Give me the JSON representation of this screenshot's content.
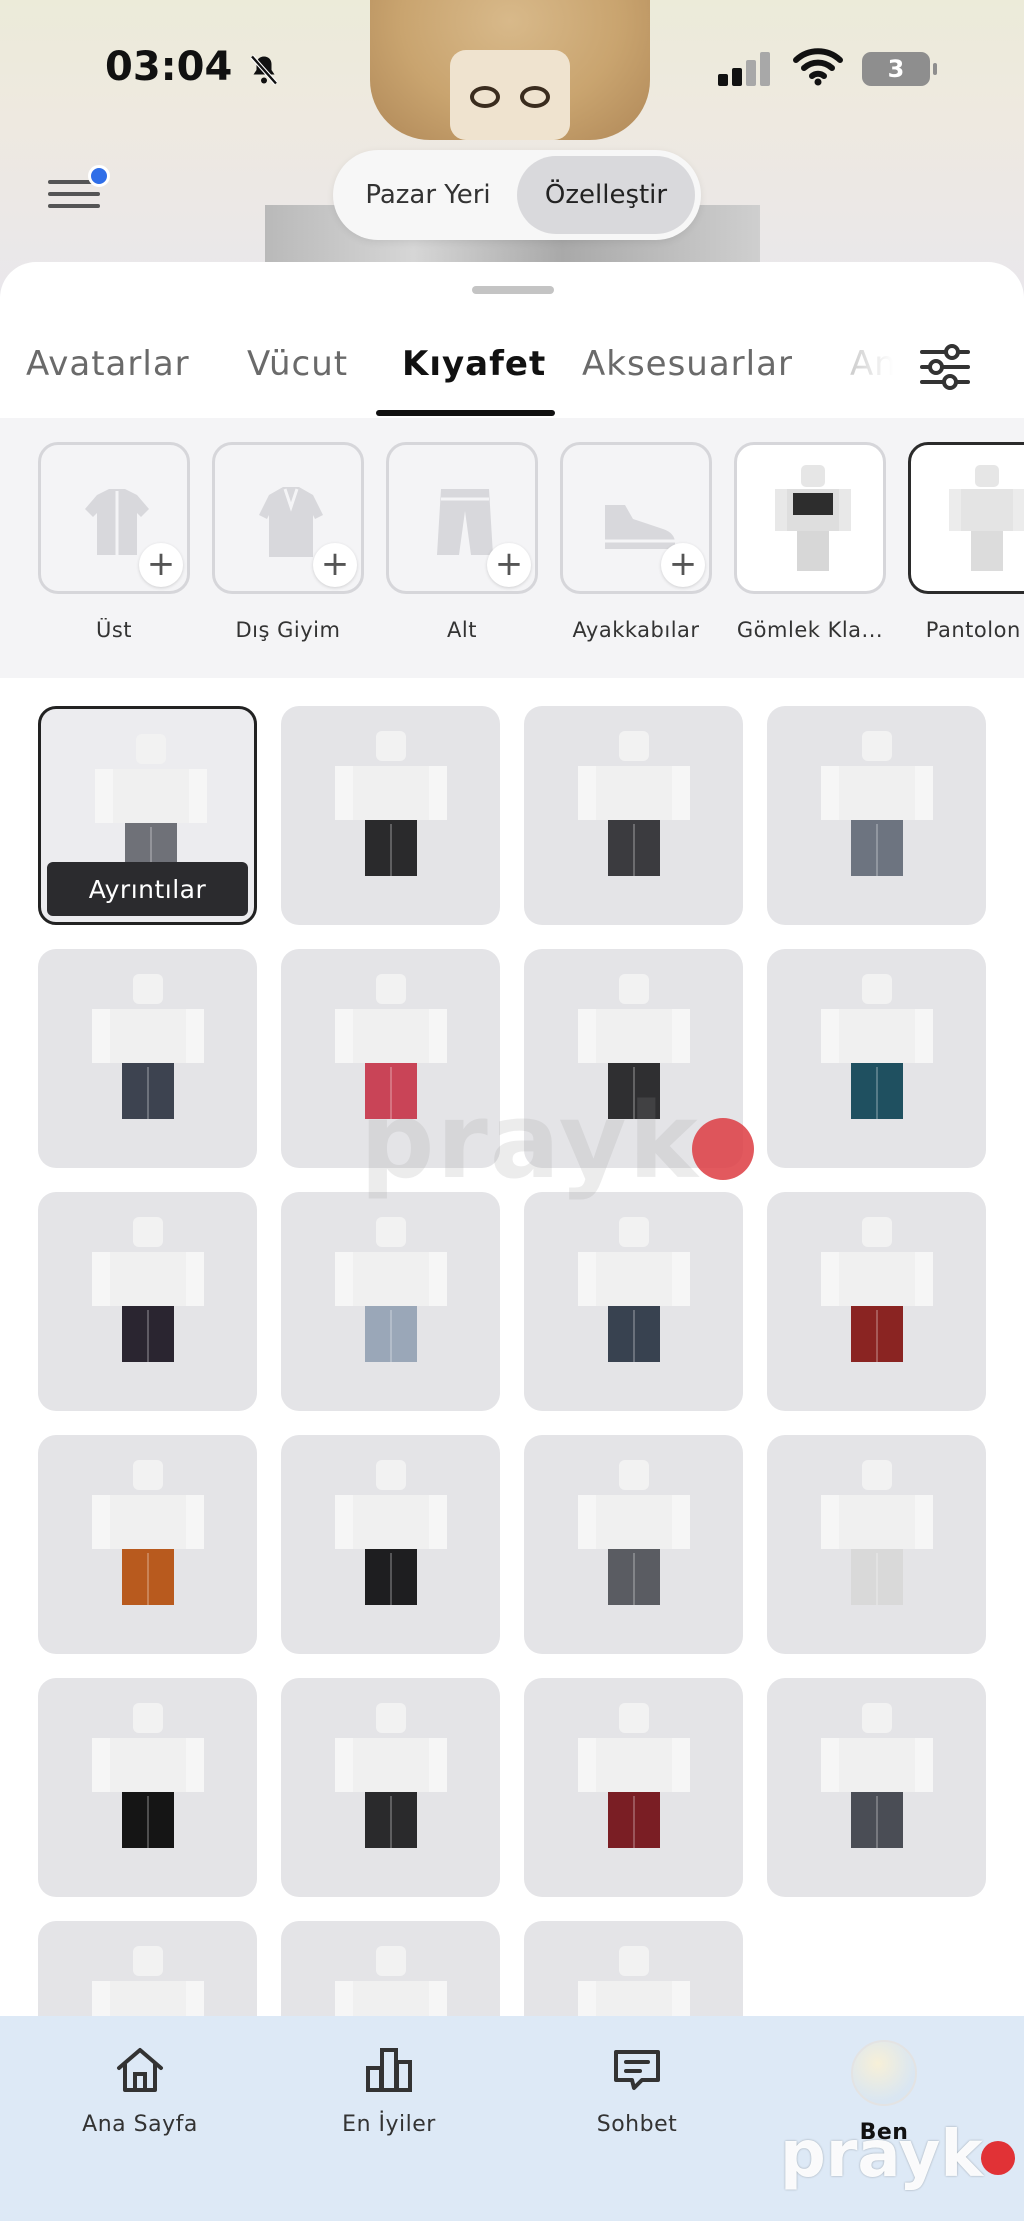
{
  "status_bar": {
    "time": "03:04",
    "battery": "3"
  },
  "header": {
    "segmented": [
      {
        "label": "Pazar Yeri",
        "active": false
      },
      {
        "label": "Özelleştir",
        "active": true
      }
    ]
  },
  "tabs": {
    "items": [
      {
        "label": "Avatarlar",
        "active": false
      },
      {
        "label": "Vücut",
        "active": false
      },
      {
        "label": "Kıyafet",
        "active": true
      },
      {
        "label": "Aksesuarlar",
        "active": false
      },
      {
        "label": "An",
        "active": false
      }
    ]
  },
  "subcategories": [
    {
      "label": "Üst",
      "icon": "shirt-icon",
      "add": true
    },
    {
      "label": "Dış Giyim",
      "icon": "jacket-icon",
      "add": true
    },
    {
      "label": "Alt",
      "icon": "pants-icon",
      "add": true
    },
    {
      "label": "Ayakkabılar",
      "icon": "sneaker-icon",
      "add": true
    },
    {
      "label": "Gömlek Kla...",
      "icon": "classic-shirt-thumbnail",
      "add": false
    },
    {
      "label": "Pantolon K",
      "icon": "classic-pants-thumbnail",
      "add": false,
      "selected": true
    }
  ],
  "items": {
    "details_label": "Ayrıntılar",
    "colors": [
      "#6f7178",
      "#2a2a2c",
      "#3b3b3f",
      "#6d7480",
      "#3d4350",
      "#c94457",
      "#2f2f31",
      "#1f5060",
      "#2a2530",
      "#9aa7b8",
      "#384250",
      "#8a2422",
      "#b85a1e",
      "#1e1e20",
      "#5a5c62",
      "#d9d9d9",
      "#151515",
      "#2a2a2c",
      "#7a1e24",
      "#4a4d55",
      "#cfcfcf",
      "#cfcfcf",
      "#cfcfcf"
    ]
  },
  "bottom_nav": [
    {
      "label": "Ana Sayfa",
      "icon": "home-icon"
    },
    {
      "label": "En İyiler",
      "icon": "bar-chart-icon"
    },
    {
      "label": "Sohbet",
      "icon": "chat-icon"
    },
    {
      "label": "Ben",
      "icon": "avatar"
    }
  ],
  "watermark": "prayk"
}
